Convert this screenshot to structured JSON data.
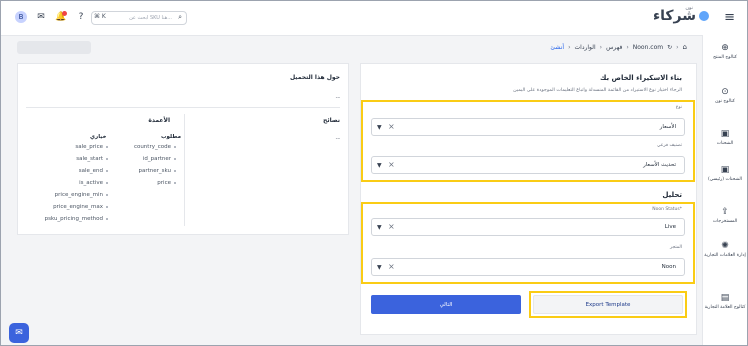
{
  "header": {
    "logo_text": "شركاء",
    "logo_sup": "نون",
    "search_placeholder": "ابحث عن SKU هنا...",
    "shortcut": "⌘ K",
    "avatar_initial": "B",
    "colors": {
      "accent": "#3b63dd",
      "highlight": "#facc15"
    }
  },
  "sidebar": {
    "items": [
      {
        "label": "كتالوج المنتج",
        "icon": "catalog-icon"
      },
      {
        "label": "كتالوج نون",
        "icon": "noon-catalog-icon"
      },
      {
        "label": "الشحنات",
        "icon": "shipments-icon"
      },
      {
        "label": "الشحنات (رئيسي)",
        "icon": "shipments-main-icon"
      },
      {
        "label": "المستخرجات",
        "icon": "exports-icon"
      },
      {
        "label": "إدارة العلامات التجارية",
        "icon": "brands-icon"
      },
      {
        "label": "كتالوج العلامة التجارية",
        "icon": "brand-catalog-icon"
      }
    ]
  },
  "breadcrumb": {
    "items": [
      "Noon.com",
      "فهرس",
      "الواردات",
      "أنشئ"
    ]
  },
  "about": {
    "title": "حول هذا التحميل",
    "text": "--",
    "tips_title": "نصائح",
    "tips_text": "--",
    "columns_title": "الأعمدة",
    "required_head": "مطلوب",
    "optional_head": "خياري",
    "required": [
      "country_code",
      "id_partner",
      "partner_sku",
      "price"
    ],
    "optional": [
      "sale_price",
      "sale_start",
      "sale_end",
      "is_active",
      "price_engine_min",
      "price_engine_max",
      "psku_pricing_method"
    ]
  },
  "form": {
    "title": "بناء الاسكيراء الخاص بك",
    "description": "الرجاء اختيار نوع الاستيراد من القائمة المنسدلة واتباع التعليمات الموجودة على اليمين",
    "field1_label": "نوع",
    "field1_value": "الأسعار",
    "field2_label": "تصنيف فرعي",
    "field2_value": "تحديث الأسعار",
    "section_title": "تحليل",
    "field3_label": "Noon Status*",
    "field3_value": "Live",
    "field4_label": "المتجر",
    "field4_value": "Noon",
    "submit_label": "التالي",
    "export_label": "Export Template"
  }
}
